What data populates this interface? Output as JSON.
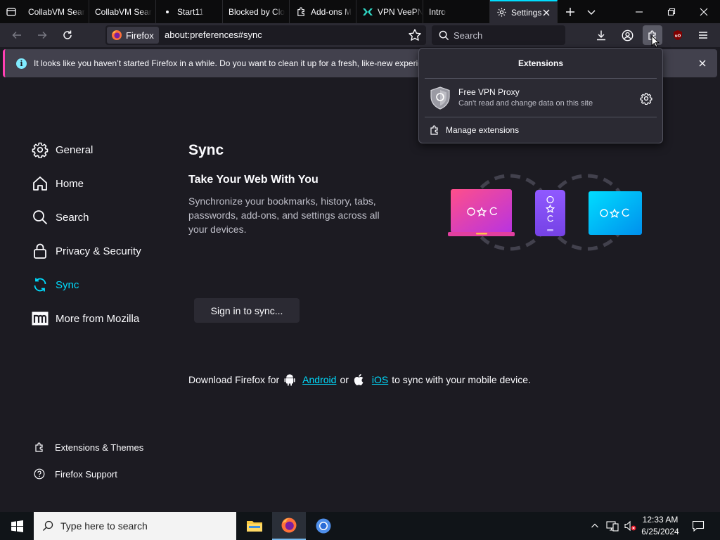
{
  "tabs": [
    {
      "title": "CollabVM Sear",
      "icon": "folder-icon"
    },
    {
      "title": "CollabVM Sear",
      "icon": "none"
    },
    {
      "title": "Start11",
      "icon": "dot-icon"
    },
    {
      "title": "Blocked by Clo",
      "icon": "none"
    },
    {
      "title": "Add-ons M",
      "icon": "puzzle-icon"
    },
    {
      "title": "VPN VeePN",
      "icon": "veepn-icon"
    },
    {
      "title": "Intro",
      "icon": "none"
    },
    {
      "title": "Settings",
      "icon": "gear-icon",
      "active": true
    }
  ],
  "navbar": {
    "identity_label": "Firefox",
    "url": "about:preferences#sync",
    "search_placeholder": "Search"
  },
  "notification": {
    "text": "It looks like you haven’t started Firefox in a while. Do you want to clean it up for a fresh, like-new experience?"
  },
  "sidebar": {
    "items": [
      {
        "label": "General",
        "icon": "gear-icon"
      },
      {
        "label": "Home",
        "icon": "home-icon"
      },
      {
        "label": "Search",
        "icon": "search-icon"
      },
      {
        "label": "Privacy & Security",
        "icon": "lock-icon"
      },
      {
        "label": "Sync",
        "icon": "sync-icon",
        "active": true
      },
      {
        "label": "More from Mozilla",
        "icon": "mozilla-icon"
      }
    ],
    "footer": [
      {
        "label": "Extensions & Themes",
        "icon": "puzzle-icon"
      },
      {
        "label": "Firefox Support",
        "icon": "help-icon"
      }
    ]
  },
  "main": {
    "title": "Sync",
    "subtitle": "Take Your Web With You",
    "description": "Synchronize your bookmarks, history, tabs, passwords, add-ons, and settings across all your devices.",
    "signin_label": "Sign in to sync...",
    "download_prefix": "Download Firefox for",
    "android_label": "Android",
    "or_label": "or",
    "ios_label": "iOS",
    "download_suffix": "to sync with your mobile device."
  },
  "extensions_panel": {
    "title": "Extensions",
    "extension_name": "Free VPN Proxy",
    "extension_permission": "Can't read and change data on this site",
    "manage_label": "Manage extensions"
  },
  "taskbar": {
    "search_placeholder": "Type here to search",
    "time": "12:33 AM",
    "date": "6/25/2024"
  },
  "colors": {
    "accent": "#00ddff",
    "background": "#1c1b22",
    "toolbar": "#2b2a33",
    "notification_stripe": "#ff3fb3"
  }
}
